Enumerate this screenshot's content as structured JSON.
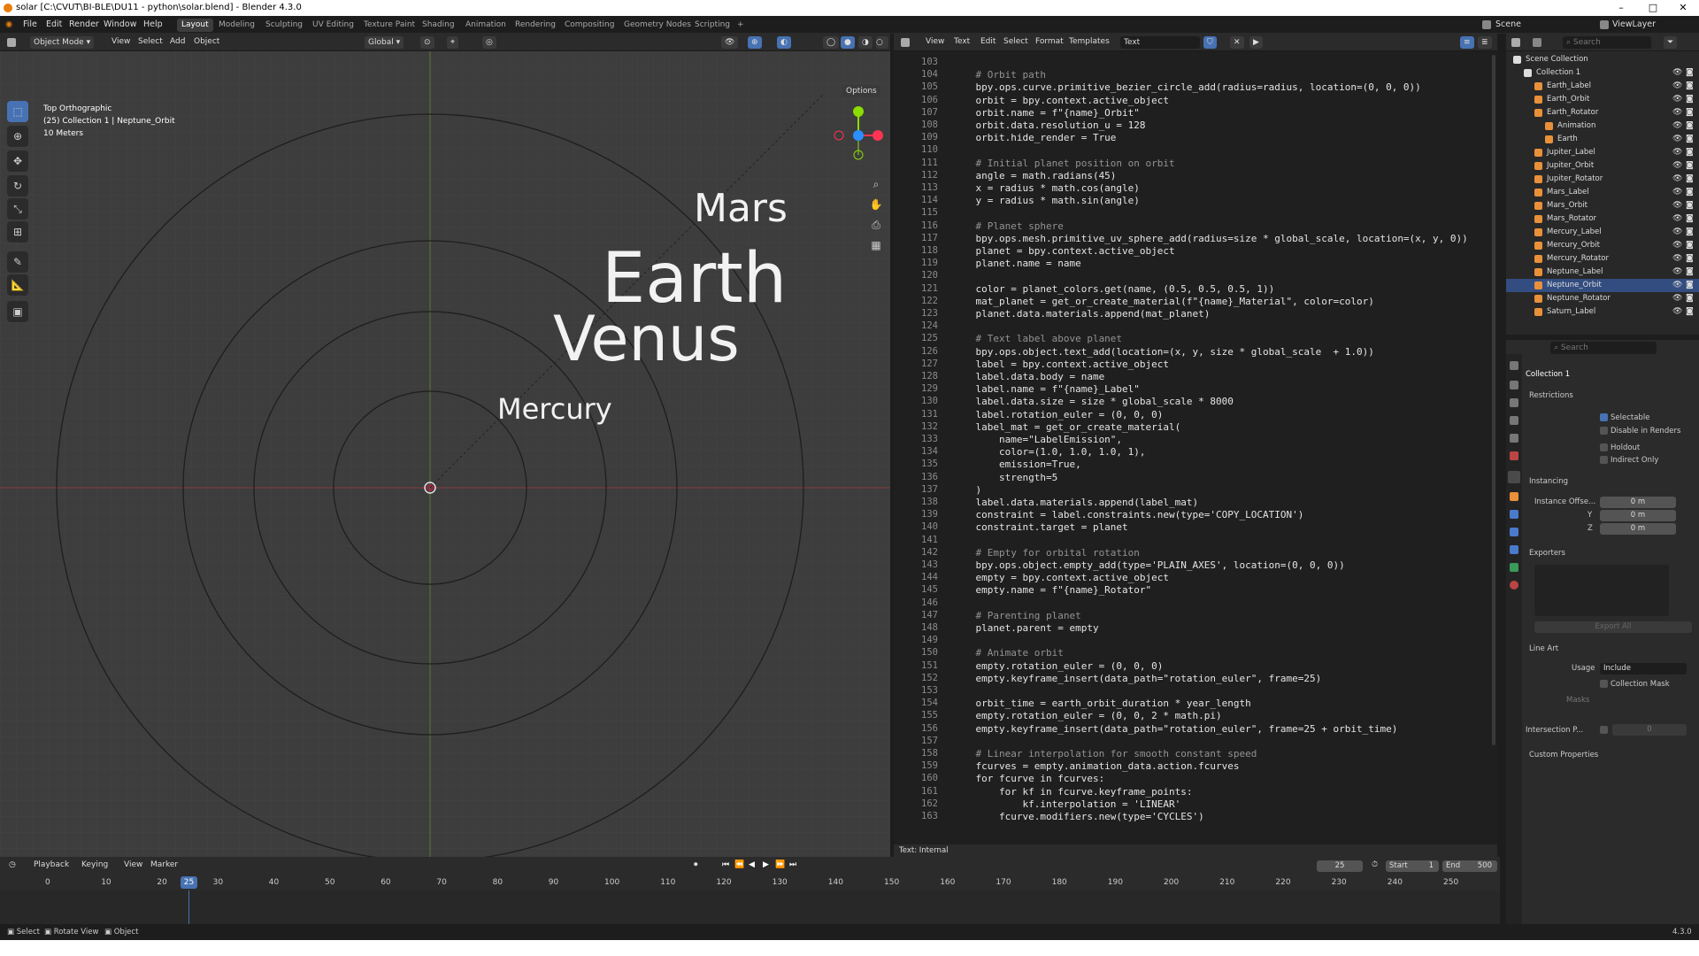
{
  "window": {
    "title": "solar [C:\\CVUT\\BI-BLE\\DU11 - python\\solar.blend] - Blender 4.3.0"
  },
  "menu": [
    "File",
    "Edit",
    "Render",
    "Window",
    "Help"
  ],
  "workspaces": [
    "Layout",
    "Modeling",
    "Sculpting",
    "UV Editing",
    "Texture Paint",
    "Shading",
    "Animation",
    "Rendering",
    "Compositing",
    "Geometry Nodes",
    "Scripting"
  ],
  "top_right": {
    "scene": "Scene",
    "view_layer": "ViewLayer"
  },
  "viewport": {
    "mode": "Object Mode",
    "menus": [
      "View",
      "Select",
      "Add",
      "Object"
    ],
    "orientation": "Global",
    "options": "Options",
    "info_view": "Top Orthographic",
    "info_collection": "(25) Collection 1 | Neptune_Orbit",
    "info_scale": "10 Meters",
    "labels": {
      "mars": "Mars",
      "earth": "Earth",
      "venus": "Venus",
      "mercury": "Mercury"
    }
  },
  "text_editor": {
    "menus": [
      "View",
      "Text",
      "Edit",
      "Select",
      "Format",
      "Templates"
    ],
    "text_name": "Text",
    "footer": "Text: Internal",
    "lines": [
      {
        "n": "103",
        "t": ""
      },
      {
        "n": "104",
        "t": "    # Orbit path"
      },
      {
        "n": "105",
        "t": "    bpy.ops.curve.primitive_bezier_circle_add(radius=radius, location=(0, 0, 0))"
      },
      {
        "n": "106",
        "t": "    orbit = bpy.context.active_object"
      },
      {
        "n": "107",
        "t": "    orbit.name = f\"{name}_Orbit\""
      },
      {
        "n": "108",
        "t": "    orbit.data.resolution_u = 128"
      },
      {
        "n": "109",
        "t": "    orbit.hide_render = True"
      },
      {
        "n": "110",
        "t": ""
      },
      {
        "n": "111",
        "t": "    # Initial planet position on orbit"
      },
      {
        "n": "112",
        "t": "    angle = math.radians(45)"
      },
      {
        "n": "113",
        "t": "    x = radius * math.cos(angle)"
      },
      {
        "n": "114",
        "t": "    y = radius * math.sin(angle)"
      },
      {
        "n": "115",
        "t": ""
      },
      {
        "n": "116",
        "t": "    # Planet sphere"
      },
      {
        "n": "117",
        "t": "    bpy.ops.mesh.primitive_uv_sphere_add(radius=size * global_scale, location=(x, y, 0))"
      },
      {
        "n": "118",
        "t": "    planet = bpy.context.active_object"
      },
      {
        "n": "119",
        "t": "    planet.name = name"
      },
      {
        "n": "120",
        "t": ""
      },
      {
        "n": "121",
        "t": "    color = planet_colors.get(name, (0.5, 0.5, 0.5, 1))"
      },
      {
        "n": "122",
        "t": "    mat_planet = get_or_create_material(f\"{name}_Material\", color=color)"
      },
      {
        "n": "123",
        "t": "    planet.data.materials.append(mat_planet)"
      },
      {
        "n": "124",
        "t": ""
      },
      {
        "n": "125",
        "t": "    # Text label above planet"
      },
      {
        "n": "126",
        "t": "    bpy.ops.object.text_add(location=(x, y, size * global_scale  + 1.0))"
      },
      {
        "n": "127",
        "t": "    label = bpy.context.active_object"
      },
      {
        "n": "128",
        "t": "    label.data.body = name"
      },
      {
        "n": "129",
        "t": "    label.name = f\"{name}_Label\""
      },
      {
        "n": "130",
        "t": "    label.data.size = size * global_scale * 8000"
      },
      {
        "n": "131",
        "t": "    label.rotation_euler = (0, 0, 0)"
      },
      {
        "n": "132",
        "t": "    label_mat = get_or_create_material("
      },
      {
        "n": "133",
        "t": "        name=\"LabelEmission\","
      },
      {
        "n": "134",
        "t": "        color=(1.0, 1.0, 1.0, 1),"
      },
      {
        "n": "135",
        "t": "        emission=True,"
      },
      {
        "n": "136",
        "t": "        strength=5"
      },
      {
        "n": "137",
        "t": "    )"
      },
      {
        "n": "138",
        "t": "    label.data.materials.append(label_mat)"
      },
      {
        "n": "139",
        "t": "    constraint = label.constraints.new(type='COPY_LOCATION')"
      },
      {
        "n": "140",
        "t": "    constraint.target = planet"
      },
      {
        "n": "141",
        "t": ""
      },
      {
        "n": "142",
        "t": "    # Empty for orbital rotation"
      },
      {
        "n": "143",
        "t": "    bpy.ops.object.empty_add(type='PLAIN_AXES', location=(0, 0, 0))"
      },
      {
        "n": "144",
        "t": "    empty = bpy.context.active_object"
      },
      {
        "n": "145",
        "t": "    empty.name = f\"{name}_Rotator\""
      },
      {
        "n": "146",
        "t": ""
      },
      {
        "n": "147",
        "t": "    # Parenting planet"
      },
      {
        "n": "148",
        "t": "    planet.parent = empty"
      },
      {
        "n": "149",
        "t": ""
      },
      {
        "n": "150",
        "t": "    # Animate orbit"
      },
      {
        "n": "151",
        "t": "    empty.rotation_euler = (0, 0, 0)"
      },
      {
        "n": "152",
        "t": "    empty.keyframe_insert(data_path=\"rotation_euler\", frame=25)"
      },
      {
        "n": "153",
        "t": ""
      },
      {
        "n": "154",
        "t": "    orbit_time = earth_orbit_duration * year_length"
      },
      {
        "n": "155",
        "t": "    empty.rotation_euler = (0, 0, 2 * math.pi)"
      },
      {
        "n": "156",
        "t": "    empty.keyframe_insert(data_path=\"rotation_euler\", frame=25 + orbit_time)"
      },
      {
        "n": "157",
        "t": ""
      },
      {
        "n": "158",
        "t": "    # Linear interpolation for smooth constant speed"
      },
      {
        "n": "159",
        "t": "    fcurves = empty.animation_data.action.fcurves"
      },
      {
        "n": "160",
        "t": "    for fcurve in fcurves:"
      },
      {
        "n": "161",
        "t": "        for kf in fcurve.keyframe_points:"
      },
      {
        "n": "162",
        "t": "            kf.interpolation = 'LINEAR'"
      },
      {
        "n": "163",
        "t": "        fcurve.modifiers.new(type='CYCLES')"
      }
    ]
  },
  "outliner": {
    "search": "Search",
    "items": [
      {
        "label": "Scene Collection",
        "depth": 0
      },
      {
        "label": "Collection 1",
        "depth": 1
      },
      {
        "label": "Earth_Label",
        "depth": 2
      },
      {
        "label": "Earth_Orbit",
        "depth": 2
      },
      {
        "label": "Earth_Rotator",
        "depth": 2
      },
      {
        "label": "Animation",
        "depth": 3
      },
      {
        "label": "Earth",
        "depth": 3
      },
      {
        "label": "Jupiter_Label",
        "depth": 2
      },
      {
        "label": "Jupiter_Orbit",
        "depth": 2
      },
      {
        "label": "Jupiter_Rotator",
        "depth": 2
      },
      {
        "label": "Mars_Label",
        "depth": 2
      },
      {
        "label": "Mars_Orbit",
        "depth": 2
      },
      {
        "label": "Mars_Rotator",
        "depth": 2
      },
      {
        "label": "Mercury_Label",
        "depth": 2
      },
      {
        "label": "Mercury_Orbit",
        "depth": 2
      },
      {
        "label": "Mercury_Rotator",
        "depth": 2
      },
      {
        "label": "Neptune_Label",
        "depth": 2
      },
      {
        "label": "Neptune_Orbit",
        "depth": 2
      },
      {
        "label": "Neptune_Rotator",
        "depth": 2
      },
      {
        "label": "Saturn_Label",
        "depth": 2
      }
    ]
  },
  "properties": {
    "search": "Search",
    "collection": "Collection 1",
    "restrictions": "Restrictions",
    "selectable": "Selectable",
    "disable_renders": "Disable in Renders",
    "holdout": "Holdout",
    "indirect_only": "Indirect Only",
    "instancing": "Instancing",
    "instance_offset": "Instance Offse...",
    "x": "0 m",
    "y": "0 m",
    "z": "0 m",
    "y_label": "Y",
    "z_label": "Z",
    "exporters": "Exporters",
    "export_all": "Export All",
    "line_art": "Line Art",
    "usage_label": "Usage",
    "usage": "Include",
    "collection_mask": "Collection Mask",
    "masks": "Masks",
    "intersection": "Intersection P...",
    "intersection_val": "0",
    "custom_props": "Custom Properties"
  },
  "timeline": {
    "menus": [
      "Playback",
      "Keying",
      "View",
      "Marker"
    ],
    "current_frame": "25",
    "start_label": "Start",
    "start": "1",
    "end_label": "End",
    "end": "500",
    "ticks": [
      "0",
      "10",
      "20",
      "30",
      "40",
      "50",
      "60",
      "70",
      "80",
      "90",
      "100",
      "110",
      "120",
      "130",
      "140",
      "150",
      "160",
      "170",
      "180",
      "190",
      "200",
      "210",
      "220",
      "230",
      "240",
      "250"
    ]
  },
  "status": {
    "select": "Select",
    "rotate": "Rotate View",
    "object": "Object",
    "version": "4.3.0"
  }
}
